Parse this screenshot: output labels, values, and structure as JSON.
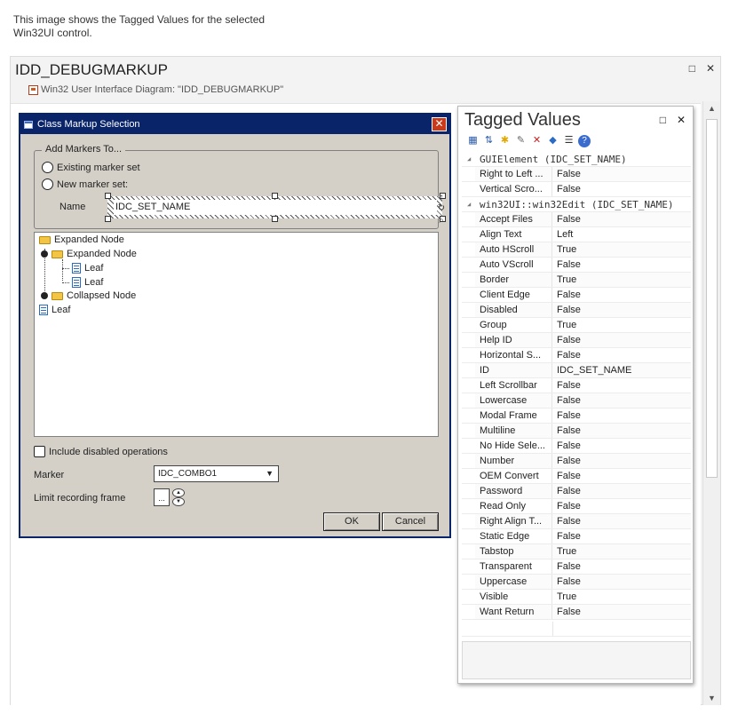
{
  "caption": {
    "line1": "This image shows the Tagged Values for the selected",
    "line2": "Win32UI control."
  },
  "diagram": {
    "title": "IDD_DEBUGMARKUP",
    "subtitle": "Win32 User Interface Diagram: \"IDD_DEBUGMARKUP\"",
    "maximize_glyph": "□",
    "close_glyph": "✕"
  },
  "dialog": {
    "title": "Class Markup Selection",
    "close_glyph": "✕",
    "group_label": "Add Markers To...",
    "radio_existing": "Existing marker set",
    "radio_new": "New marker set:",
    "name_label": "Name",
    "name_value": "IDC_SET_NAME",
    "tree": [
      {
        "label": "Expanded Node"
      },
      {
        "label": "Expanded Node"
      },
      {
        "label": "Leaf"
      },
      {
        "label": "Leaf"
      },
      {
        "label": "Collapsed Node"
      },
      {
        "label": "Leaf"
      }
    ],
    "include_disabled": "Include disabled operations",
    "marker_label": "Marker",
    "marker_value": "IDC_COMBO1",
    "limit_label": "Limit recording frame",
    "limit_btn": "...",
    "ok": "OK",
    "cancel": "Cancel"
  },
  "tagged_values": {
    "title": "Tagged Values",
    "maximize_glyph": "□",
    "close_glyph": "✕",
    "toolbar_icons": [
      "categorized-view-icon",
      "sort-az-icon",
      "new-tag-icon",
      "edit-tag-icon",
      "delete-icon",
      "tag-library-icon",
      "filter-icon",
      "help-icon"
    ],
    "categories": [
      {
        "name": "GUIElement (IDC_SET_NAME)",
        "rows": [
          {
            "name": "Right to Left ...",
            "value": "False"
          },
          {
            "name": "Vertical Scro...",
            "value": "False"
          }
        ]
      },
      {
        "name": "win32UI::win32Edit (IDC_SET_NAME)",
        "rows": [
          {
            "name": "Accept Files",
            "value": "False"
          },
          {
            "name": "Align Text",
            "value": "Left"
          },
          {
            "name": "Auto HScroll",
            "value": "True"
          },
          {
            "name": "Auto VScroll",
            "value": "False"
          },
          {
            "name": "Border",
            "value": "True"
          },
          {
            "name": "Client Edge",
            "value": "False"
          },
          {
            "name": "Disabled",
            "value": "False"
          },
          {
            "name": "Group",
            "value": "True"
          },
          {
            "name": "Help ID",
            "value": "False"
          },
          {
            "name": "Horizontal S...",
            "value": "False"
          },
          {
            "name": "ID",
            "value": "IDC_SET_NAME"
          },
          {
            "name": "Left Scrollbar",
            "value": "False"
          },
          {
            "name": "Lowercase",
            "value": "False"
          },
          {
            "name": "Modal Frame",
            "value": "False"
          },
          {
            "name": "Multiline",
            "value": "False"
          },
          {
            "name": "No Hide Sele...",
            "value": "False"
          },
          {
            "name": "Number",
            "value": "False"
          },
          {
            "name": "OEM Convert",
            "value": "False"
          },
          {
            "name": "Password",
            "value": "False"
          },
          {
            "name": "Read Only",
            "value": "False"
          },
          {
            "name": "Right Align T...",
            "value": "False"
          },
          {
            "name": "Static Edge",
            "value": "False"
          },
          {
            "name": "Tabstop",
            "value": "True"
          },
          {
            "name": "Transparent",
            "value": "False"
          },
          {
            "name": "Uppercase",
            "value": "False"
          },
          {
            "name": "Visible",
            "value": "True"
          },
          {
            "name": "Want Return",
            "value": "False"
          }
        ]
      }
    ]
  },
  "colors": {
    "dialog_title_bar": "#0a246a",
    "dialog_face": "#d4d0c8",
    "close_button": "#c83a1a"
  }
}
